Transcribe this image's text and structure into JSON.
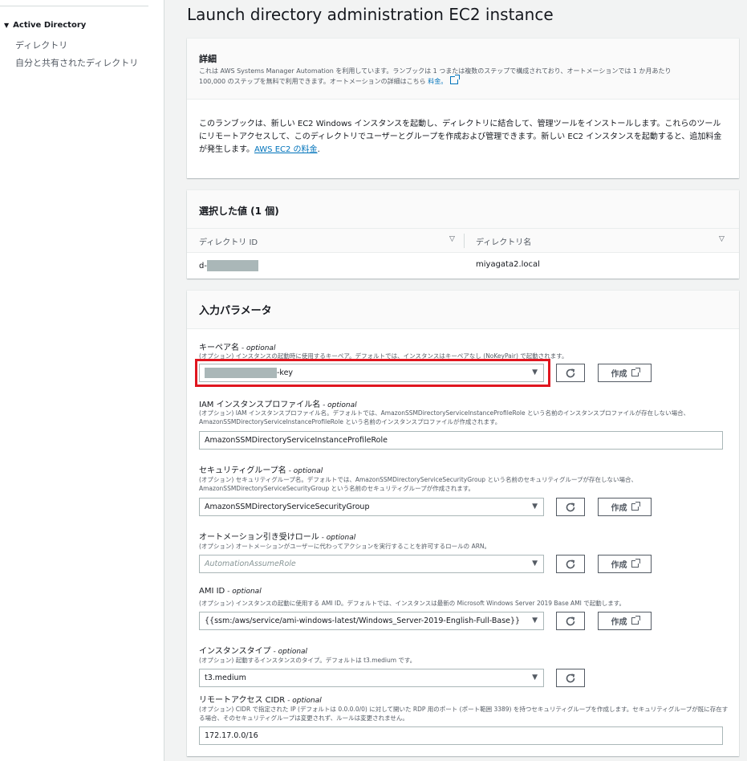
{
  "sidebar": {
    "section": "Active Directory",
    "items": [
      "ディレクトリ",
      "自分と共有されたディレクトリ"
    ]
  },
  "page": {
    "title": "Launch directory administration EC2 instance"
  },
  "details": {
    "heading": "詳細",
    "desc_line1": "これは AWS Systems Manager Automation を利用しています。ランブックは 1 つまたは複数のステップで構成されており、オートメーションでは 1 か月あたり",
    "desc_line2": "100,000 のステップを無料で利用できます。オートメーションの詳細はこちら",
    "pricing_link": "料金。",
    "body": "このランブックは、新しい EC2 Windows インスタンスを起動し、ディレクトリに結合して、管理ツールをインストールします。これらのツールにリモートアクセスして、このディレクトリでユーザーとグループを作成および管理できます。新しい EC2 インスタンスを起動すると、追加料金が発生します。",
    "ec2_link": "AWS EC2 の料金",
    "ec2_suffix": "."
  },
  "selected": {
    "title": "選択した値 (1 個)",
    "columns": [
      "ディレクトリ ID",
      "ディレクトリ名"
    ],
    "row": {
      "id_prefix": "d-",
      "name": "miyagata2.local"
    }
  },
  "params": {
    "title": "入力パラメータ",
    "optional": " - optional",
    "refresh_icon": "refresh-icon",
    "create_label": "作成",
    "keypair": {
      "label": "キーペア名",
      "desc": "(オプション) インスタンスの起動時に使用するキーペア。デフォルトでは、インスタンスはキーペアなし (NoKeyPair) で起動されます。",
      "value_suffix": "-key"
    },
    "iam": {
      "label": "IAM インスタンスプロファイル名",
      "desc": "(オプション) IAM インスタンスプロファイル名。デフォルトでは、AmazonSSMDirectoryServiceInstanceProfileRole という名前のインスタンスプロファイルが存在しない場合、AmazonSSMDirectoryServiceInstanceProfileRole という名前のインスタンスプロファイルが作成されます。",
      "value": "AmazonSSMDirectoryServiceInstanceProfileRole"
    },
    "sg": {
      "label": "セキュリティグループ名",
      "desc": "(オプション) セキュリティグループ名。デフォルトでは、AmazonSSMDirectoryServiceSecurityGroup という名前のセキュリティグループが存在しない場合、AmazonSSMDirectoryServiceSecurityGroup という名前のセキュリティグループが作成されます。",
      "value": "AmazonSSMDirectoryServiceSecurityGroup"
    },
    "role": {
      "label": "オートメーション引き受けロール",
      "desc": "(オプション) オートメーションがユーザーに代わってアクションを実行することを許可するロールの ARN。",
      "placeholder": "AutomationAssumeRole"
    },
    "ami": {
      "label": "AMI ID",
      "desc": "(オプション) インスタンスの起動に使用する AMI ID。デフォルトでは、インスタンスは最新の Microsoft Windows Server 2019 Base AMI で起動します。",
      "value": "{{ssm:/aws/service/ami-windows-latest/Windows_Server-2019-English-Full-Base}}"
    },
    "itype": {
      "label": "インスタンスタイプ",
      "desc": "(オプション) 起動するインスタンスのタイプ。デフォルトは t3.medium です。",
      "value": "t3.medium"
    },
    "cidr": {
      "label": "リモートアクセス CIDR",
      "desc": "(オプション) CIDR で指定された IP (デフォルトは 0.0.0.0/0) に対して開いた RDP 用のポート (ポート範囲 3389) を持つセキュリティグループを作成します。セキュリティグループが既に存在する場合、そのセキュリティグループは変更されず、ルールは変更されません。",
      "value": "172.17.0.0/16"
    }
  }
}
